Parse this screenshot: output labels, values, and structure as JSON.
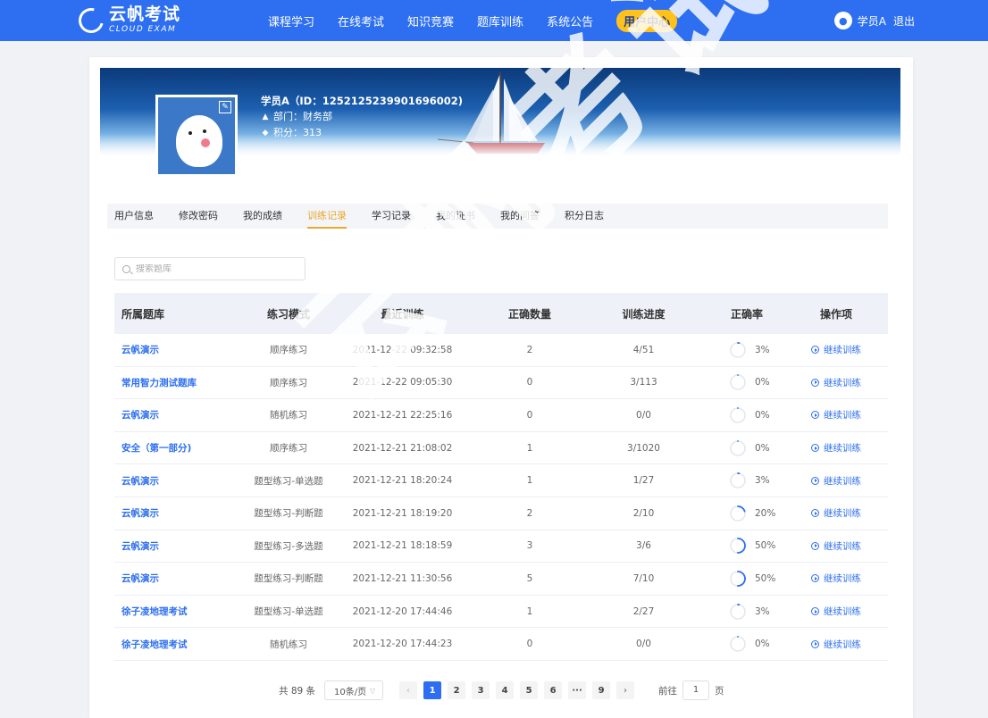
{
  "app": {
    "logo_cn": "云帆考试",
    "logo_en": "CLOUD EXAM"
  },
  "nav": {
    "items": [
      {
        "label": "课程学习"
      },
      {
        "label": "在线考试"
      },
      {
        "label": "知识竞赛"
      },
      {
        "label": "题库训练"
      },
      {
        "label": "系统公告"
      },
      {
        "label": "用户中心",
        "active": true
      }
    ]
  },
  "user": {
    "name": "学员A",
    "logout": "退出"
  },
  "profile": {
    "title": "学员A（ID：1252125239901696002)",
    "department": "部门：财务部",
    "points": "积分：313"
  },
  "tabs": [
    {
      "label": "用户信息"
    },
    {
      "label": "修改密码"
    },
    {
      "label": "我的成绩"
    },
    {
      "label": "训练记录",
      "active": true
    },
    {
      "label": "学习记录"
    },
    {
      "label": "我的证书"
    },
    {
      "label": "我的问答"
    },
    {
      "label": "积分日志"
    }
  ],
  "search": {
    "placeholder": "搜索题库"
  },
  "table": {
    "headers": [
      "所属题库",
      "练习模式",
      "最近训练",
      "正确数量",
      "训练进度",
      "正确率",
      "操作项"
    ],
    "rows": [
      {
        "bank": "云帆演示",
        "mode": "顺序练习",
        "time": "2021-12-22 09:32:58",
        "correct": "2",
        "progress": "4/51",
        "rate": "3%",
        "rate_value": 3,
        "action": "继续训练"
      },
      {
        "bank": "常用智力测试题库",
        "mode": "顺序练习",
        "time": "2021-12-22 09:05:30",
        "correct": "0",
        "progress": "3/113",
        "rate": "0%",
        "rate_value": 0,
        "action": "继续训练"
      },
      {
        "bank": "云帆演示",
        "mode": "随机练习",
        "time": "2021-12-21 22:25:16",
        "correct": "0",
        "progress": "0/0",
        "rate": "0%",
        "rate_value": 0,
        "action": "继续训练"
      },
      {
        "bank": "安全（第一部分)",
        "mode": "顺序练习",
        "time": "2021-12-21 21:08:02",
        "correct": "1",
        "progress": "3/1020",
        "rate": "0%",
        "rate_value": 0,
        "action": "继续训练"
      },
      {
        "bank": "云帆演示",
        "mode": "题型练习-单选题",
        "time": "2021-12-21 18:20:24",
        "correct": "1",
        "progress": "1/27",
        "rate": "3%",
        "rate_value": 3,
        "action": "继续训练"
      },
      {
        "bank": "云帆演示",
        "mode": "题型练习-判断题",
        "time": "2021-12-21 18:19:20",
        "correct": "2",
        "progress": "2/10",
        "rate": "20%",
        "rate_value": 20,
        "action": "继续训练"
      },
      {
        "bank": "云帆演示",
        "mode": "题型练习-多选题",
        "time": "2021-12-21 18:18:59",
        "correct": "3",
        "progress": "3/6",
        "rate": "50%",
        "rate_value": 50,
        "action": "继续训练"
      },
      {
        "bank": "云帆演示",
        "mode": "题型练习-判断题",
        "time": "2021-12-21 11:30:56",
        "correct": "5",
        "progress": "7/10",
        "rate": "50%",
        "rate_value": 50,
        "action": "继续训练"
      },
      {
        "bank": "徐子凌地理考试",
        "mode": "题型练习-单选题",
        "time": "2021-12-20 17:44:46",
        "correct": "1",
        "progress": "2/27",
        "rate": "3%",
        "rate_value": 3,
        "action": "继续训练"
      },
      {
        "bank": "徐子凌地理考试",
        "mode": "随机练习",
        "time": "2021-12-20 17:44:23",
        "correct": "0",
        "progress": "0/0",
        "rate": "0%",
        "rate_value": 0,
        "action": "继续训练"
      }
    ]
  },
  "pagination": {
    "total": "共 89 条",
    "page_size": "10条/页",
    "pages": [
      "1",
      "2",
      "3",
      "4",
      "5",
      "6",
      "···",
      "9"
    ],
    "current": "1",
    "goto_prefix": "前往",
    "goto_value": "1",
    "goto_suffix": "页"
  },
  "watermark": "云帆考试",
  "colors": {
    "primary": "#2d6ff0",
    "accent": "#ffc21a",
    "tab_active": "#e9a82a"
  }
}
